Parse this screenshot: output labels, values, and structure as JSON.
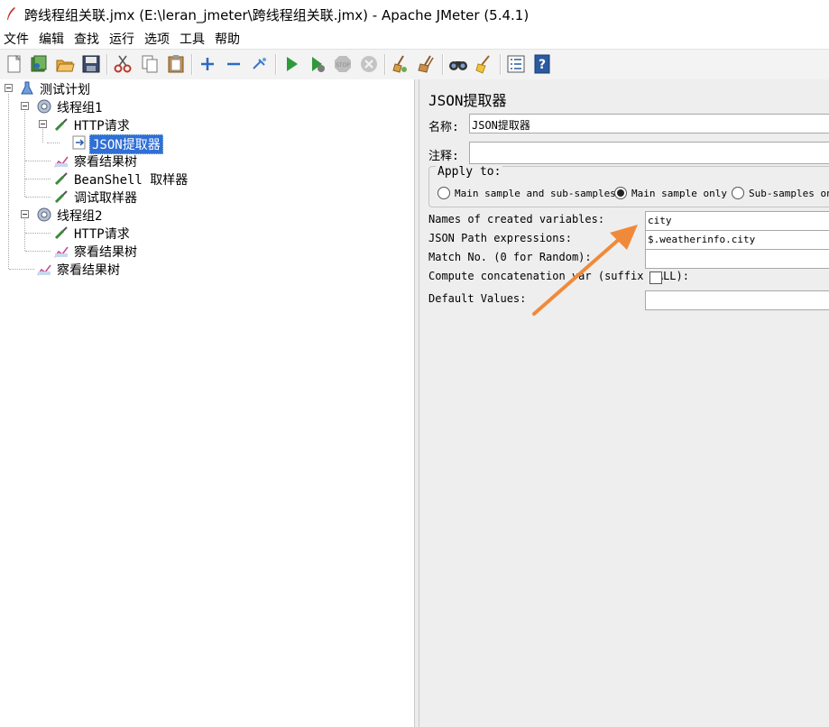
{
  "window": {
    "title": "跨线程组关联.jmx (E:\\leran_jmeter\\跨线程组关联.jmx) - Apache JMeter (5.4.1)"
  },
  "menu": [
    "文件",
    "编辑",
    "查找",
    "运行",
    "选项",
    "工具",
    "帮助"
  ],
  "toolbar": {
    "icons": [
      "new-icon",
      "templates-icon",
      "open-icon",
      "save-icon",
      "cut-icon",
      "copy-icon",
      "paste-icon",
      "expand-icon",
      "collapse-icon",
      "toggle-icon",
      "start-icon",
      "start-no-pause-icon",
      "stop-icon",
      "shutdown-icon",
      "clear-icon",
      "clear-all-icon",
      "search-icon",
      "reset-search-icon",
      "function-helper-icon",
      "help-icon"
    ]
  },
  "tree": {
    "test_plan": "测试计划",
    "thread_group_1": "线程组1",
    "http_request_1": "HTTP请求",
    "json_extractor": "JSON提取器",
    "view_results_tree_1": "察看结果树",
    "beanshell_sampler": "BeanShell 取样器",
    "debug_sampler": "调试取样器",
    "thread_group_2": "线程组2",
    "http_request_2": "HTTP请求",
    "view_results_tree_2": "察看结果树",
    "view_results_tree_3": "察看结果树"
  },
  "panel": {
    "title": "JSON提取器",
    "name_label": "名称:",
    "name_value": "JSON提取器",
    "comment_label": "注释:",
    "comment_value": "",
    "apply_to": {
      "title": "Apply to:",
      "options": [
        {
          "label": "Main sample and sub-samples",
          "selected": false
        },
        {
          "label": "Main sample only",
          "selected": true
        },
        {
          "label": "Sub-samples only",
          "selected": false
        }
      ]
    },
    "fields": {
      "names_label": "Names of created variables:",
      "names_value": "city",
      "jsonpath_label": "JSON Path expressions:",
      "jsonpath_value": "$.weatherinfo.city",
      "match_label": "Match No. (0 for Random):",
      "match_value": "",
      "concat_label": "Compute concatenation var (suffix _ALL):",
      "concat_checked": false,
      "default_label": "Default Values:",
      "default_value": ""
    }
  },
  "annotation": {
    "arrow_color": "#f08a3a"
  }
}
